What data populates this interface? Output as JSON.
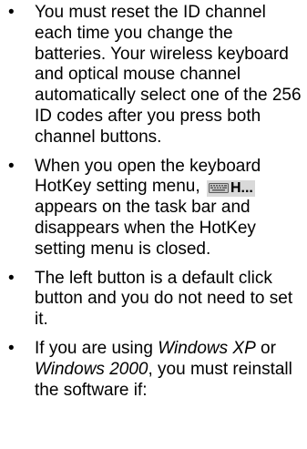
{
  "bullet_char": "•",
  "items": [
    {
      "text": "You must reset the ID channel each time you change the batteries. Your wireless keyboard and optical mouse channel automatically select one of the 256 ID codes after you press both channel buttons."
    },
    {
      "before": "When you open the keyboard HotKey setting menu, ",
      "taskbar_label": "H...",
      "after": " appears on the task bar and disappears when the HotKey setting menu is closed."
    },
    {
      "text": "The left button is a default click button and you do not need to set it."
    },
    {
      "part1": "If you are using ",
      "os1": "Windows XP",
      "part2": " or ",
      "os2": "Windows 2000",
      "part3": ", you must reinstall the software if:"
    }
  ],
  "icons": {
    "taskbar": "keyboard-icon"
  }
}
